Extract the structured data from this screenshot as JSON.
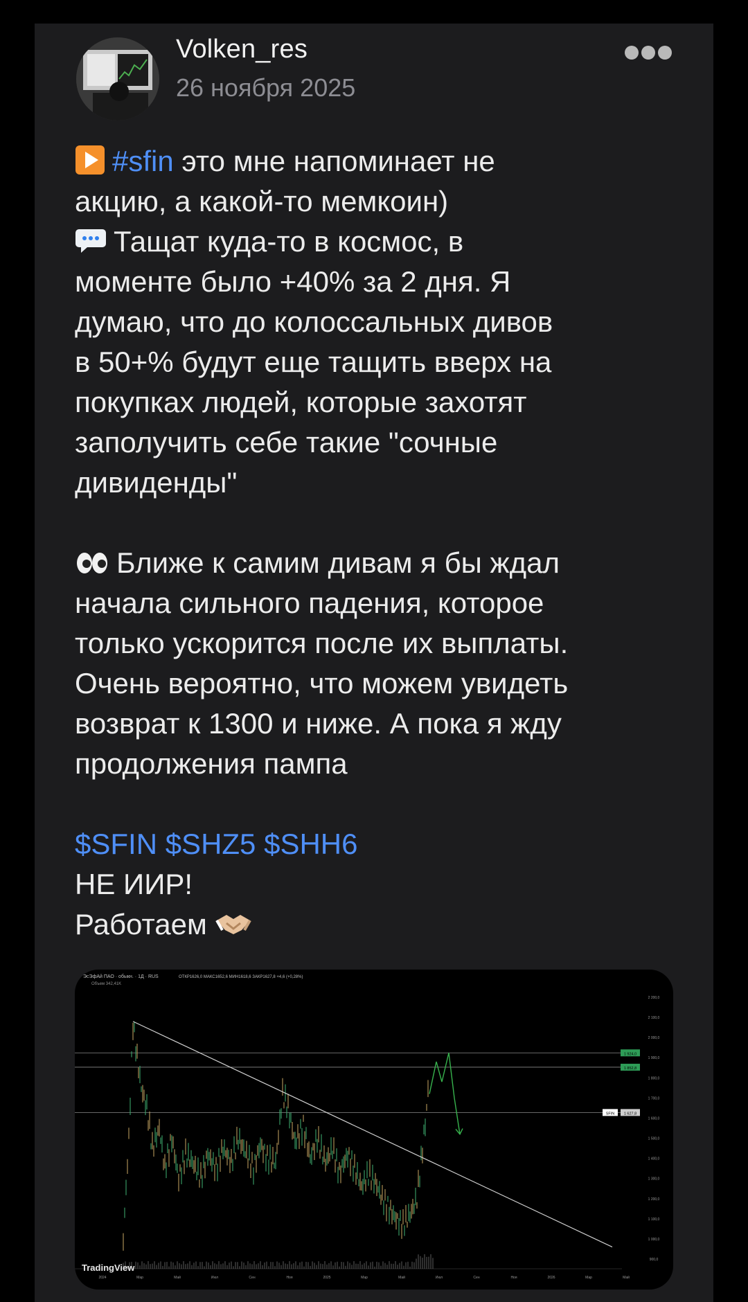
{
  "post": {
    "author": "Volken_res",
    "date": "26 ноября 2025",
    "lines": [
      {
        "parts": [
          {
            "icon": "play-button-emoji"
          },
          {
            "text": "#sfin",
            "link": true
          },
          {
            "text": " это мне напоминает не"
          }
        ]
      },
      {
        "parts": [
          {
            "text": "акцию, а какой-то мемкоин)"
          }
        ]
      },
      {
        "parts": [
          {
            "icon": "speech-bubble-emoji"
          },
          {
            "text": "Тащат куда-то в космос, в"
          }
        ]
      },
      {
        "parts": [
          {
            "text": "моменте было +40% за 2 дня. Я"
          }
        ]
      },
      {
        "parts": [
          {
            "text": "думаю, что до колоссальных дивов"
          }
        ]
      },
      {
        "parts": [
          {
            "text": "в 50+% будут еще тащить вверх на"
          }
        ]
      },
      {
        "parts": [
          {
            "text": "покупках людей, которые захотят"
          }
        ]
      },
      {
        "parts": [
          {
            "text": "заполучить себе такие \"сочные"
          }
        ]
      },
      {
        "parts": [
          {
            "text": "дивиденды\""
          }
        ]
      },
      {
        "blank": true
      },
      {
        "parts": [
          {
            "icon": "eyes-emoji"
          },
          {
            "text": "Ближе к самим дивам я бы ждал"
          }
        ]
      },
      {
        "parts": [
          {
            "text": "начала сильного падения, которое"
          }
        ]
      },
      {
        "parts": [
          {
            "text": "только ускорится после их выплаты."
          }
        ]
      },
      {
        "parts": [
          {
            "text": "Очень вероятно, что можем увидеть"
          }
        ]
      },
      {
        "parts": [
          {
            "text": "возврат к 1300 и ниже. А пока я жду"
          }
        ]
      },
      {
        "parts": [
          {
            "text": "продолжения пампа"
          }
        ]
      },
      {
        "blank": true
      },
      {
        "parts": [
          {
            "text": "$SFIN",
            "link": true
          },
          {
            "text": " "
          },
          {
            "text": "$SHZ5",
            "link": true
          },
          {
            "text": " "
          },
          {
            "text": "$SHH6",
            "link": true
          }
        ]
      },
      {
        "parts": [
          {
            "text": "НЕ ИИР!"
          }
        ]
      },
      {
        "parts": [
          {
            "text": "Работаем "
          },
          {
            "icon": "handshake-emoji"
          }
        ]
      }
    ]
  },
  "chart": {
    "header": "ЭсЭфАй ПАО · обыкн. · 1Д · RUS",
    "ohlc": "ОТКР1626,0 МАКС1652,6 МИН1618,6 ЗАКР1627,8 +4,6 (+0,28%)",
    "volume_label": "Объем 342,41K",
    "watermark": "TradingView",
    "y_ticks": [
      "2 200,0",
      "2 100,0",
      "2 000,0",
      "1 900,0",
      "1 800,0",
      "1 700,0",
      "1 600,0",
      "1 500,0",
      "1 400,0",
      "1 300,0",
      "1 200,0",
      "1 100,0",
      "1 000,0",
      "900,0"
    ],
    "x_ticks": [
      "2024",
      "Мар",
      "Май",
      "Июл",
      "Сен",
      "Ноя",
      "2025",
      "Мар",
      "Май",
      "Июл",
      "Сен",
      "Ноя",
      "2026",
      "Мар",
      "Май"
    ],
    "price_badges": [
      {
        "label": "1 924,0",
        "color": "#2e9c57"
      },
      {
        "label": "1 852,8",
        "color": "#2e9c57"
      },
      {
        "label": "1 627,8",
        "color": "#cfcfcf"
      }
    ],
    "ticker_badge": "SFIN",
    "colors": {
      "up": "#3aa36a",
      "down": "#b89a5a",
      "trend": "#d0d0d0",
      "projection": "#37b24d"
    }
  }
}
